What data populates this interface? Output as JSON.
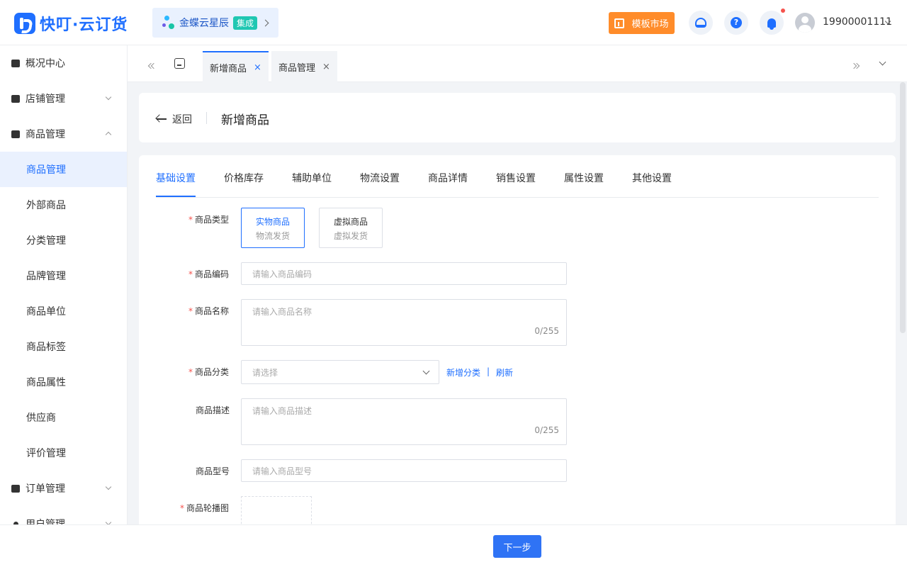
{
  "header": {
    "brand": "快叮·云订货",
    "integration": {
      "label": "金蝶云星辰",
      "badge": "集成"
    },
    "market_label": "模板市场",
    "user_phone": "19900001111"
  },
  "sidebar": {
    "groups": [
      {
        "label": "概况中心"
      },
      {
        "label": "店铺管理"
      },
      {
        "label": "商品管理"
      },
      {
        "label": "订单管理"
      },
      {
        "label": "用户管理"
      }
    ],
    "product_items": [
      "商品管理",
      "外部商品",
      "分类管理",
      "品牌管理",
      "商品单位",
      "商品标签",
      "商品属性",
      "供应商",
      "评价管理"
    ]
  },
  "tabs": [
    {
      "label": "新增商品",
      "close": "×"
    },
    {
      "label": "商品管理",
      "close": "×"
    }
  ],
  "page": {
    "back_label": "返回",
    "title": "新增商品"
  },
  "form_tabs": [
    "基础设置",
    "价格库存",
    "辅助单位",
    "物流设置",
    "商品详情",
    "销售设置",
    "属性设置",
    "其他设置"
  ],
  "form": {
    "required_mark": "*",
    "type": {
      "label": "商品类型",
      "options": [
        {
          "title": "实物商品",
          "sub": "物流发货"
        },
        {
          "title": "虚拟商品",
          "sub": "虚拟发货"
        }
      ]
    },
    "code": {
      "label": "商品编码",
      "placeholder": "请输入商品编码"
    },
    "name": {
      "label": "商品名称",
      "placeholder": "请输入商品名称",
      "counter": "0/255"
    },
    "category": {
      "label": "商品分类",
      "placeholder": "请选择",
      "add_link": "新增分类",
      "divider": "|",
      "refresh_link": "刷新"
    },
    "desc": {
      "label": "商品描述",
      "placeholder": "请输入商品描述",
      "counter": "0/255"
    },
    "model": {
      "label": "商品型号",
      "placeholder": "请输入商品型号"
    },
    "carousel": {
      "label": "商品轮播图"
    }
  },
  "footer": {
    "next_label": "下一步"
  },
  "colors": {
    "primary": "#1f6fff",
    "accent_orange": "#ff8c2a",
    "required": "#f5534d"
  }
}
